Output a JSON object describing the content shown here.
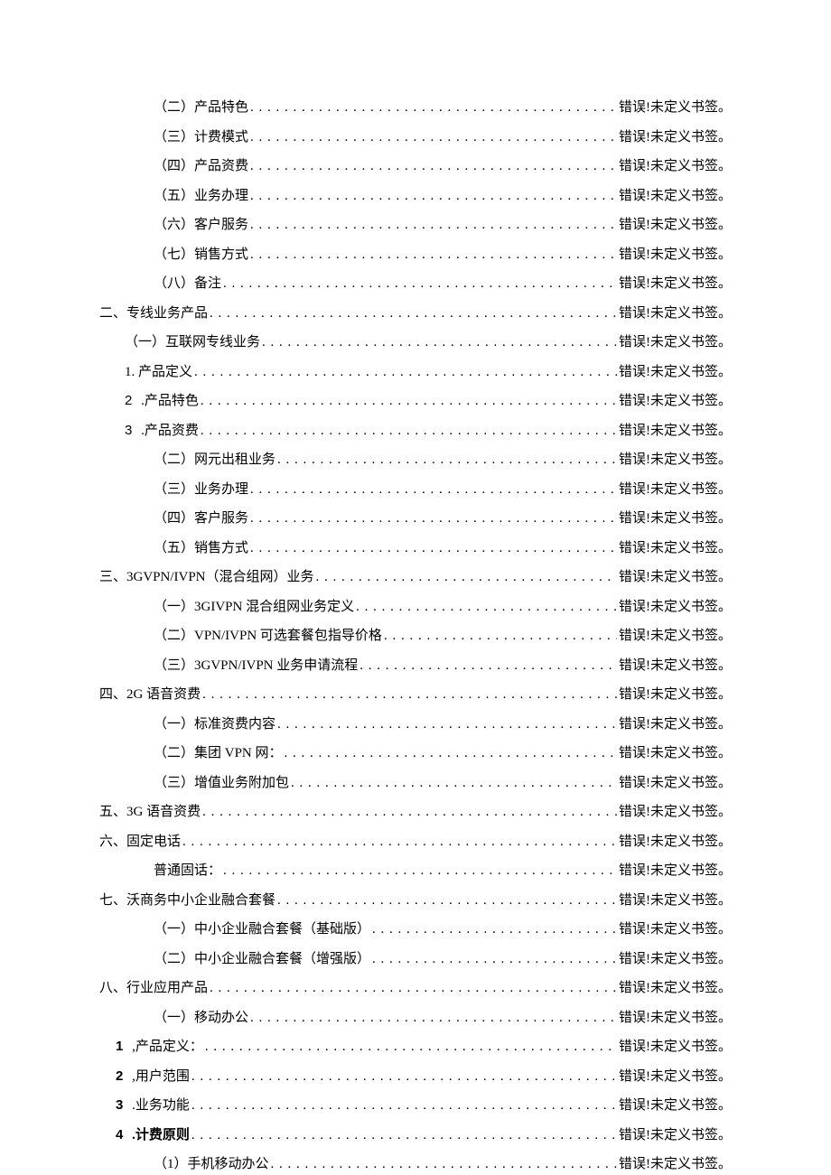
{
  "error_text": "错误!未定义书签。",
  "entries": [
    {
      "label": "（二）产品特色",
      "indent": "indent-1"
    },
    {
      "label": "（三）计费模式",
      "indent": "indent-1"
    },
    {
      "label": "（四）产品资费",
      "indent": "indent-1"
    },
    {
      "label": "（五）业务办理",
      "indent": "indent-1"
    },
    {
      "label": "（六）客户服务",
      "indent": "indent-1"
    },
    {
      "label": "（七）销售方式",
      "indent": "indent-1"
    },
    {
      "label": "（八）备注",
      "indent": "indent-1"
    },
    {
      "label": "二、专线业务产品",
      "indent": "indent-0"
    },
    {
      "label": "（一）互联网专线业务",
      "indent": "indent-b"
    },
    {
      "label": "1. 产品定义",
      "indent": "indent-b"
    },
    {
      "num": "2",
      "label": " .产品特色",
      "indent": "indent-b",
      "num_style": "num-plain"
    },
    {
      "num": "3",
      "label": " .产品资费",
      "indent": "indent-b",
      "num_style": "num-plain"
    },
    {
      "label": "（二）网元出租业务",
      "indent": "indent-1"
    },
    {
      "label": "（三）业务办理",
      "indent": "indent-1"
    },
    {
      "label": "（四）客户服务",
      "indent": "indent-1"
    },
    {
      "label": "（五）销售方式",
      "indent": "indent-1"
    },
    {
      "label": "三、3GVPN/IVPN（混合组网）业务",
      "indent": "indent-0"
    },
    {
      "label": "（一）3GIVPN 混合组网业务定义",
      "indent": "indent-1"
    },
    {
      "label": "（二）VPN/IVPN 可选套餐包指导价格",
      "indent": "indent-1"
    },
    {
      "label": "（三）3GVPN/IVPN 业务申请流程",
      "indent": "indent-1"
    },
    {
      "label": "四、2G 语音资费",
      "indent": "indent-0"
    },
    {
      "label": "（一）标准资费内容",
      "indent": "indent-1"
    },
    {
      "label": "（二）集团 VPN 网：",
      "indent": "indent-1"
    },
    {
      "label": "（三）增值业务附加包",
      "indent": "indent-1"
    },
    {
      "label": "五、3G 语音资费",
      "indent": "indent-0"
    },
    {
      "label": "六、固定电话",
      "indent": "indent-0"
    },
    {
      "label": "普通固话：",
      "indent": "indent-1"
    },
    {
      "label": "七、沃商务中小企业融合套餐",
      "indent": "indent-0"
    },
    {
      "label": "（一）中小企业融合套餐（基础版）",
      "indent": "indent-1"
    },
    {
      "label": "（二）中小企业融合套餐（增强版）",
      "indent": "indent-1"
    },
    {
      "label": "八、行业应用产品",
      "indent": "indent-0"
    },
    {
      "label": "（一）移动办公",
      "indent": "indent-1"
    },
    {
      "num": "1",
      "label": " ,产品定义：",
      "indent": "indent-c",
      "num_style": "num-bold"
    },
    {
      "num": "2",
      "label": " ,用户范围",
      "indent": "indent-c",
      "num_style": "num-bold"
    },
    {
      "num": "3",
      "label": " .业务功能",
      "indent": "indent-c",
      "num_style": "num-bold"
    },
    {
      "num": "4",
      "label": " .计费原则",
      "indent": "indent-c",
      "num_style": "num-bold",
      "bold_label": true
    },
    {
      "label": "（1）手机移动办公",
      "indent": "indent-1"
    }
  ]
}
